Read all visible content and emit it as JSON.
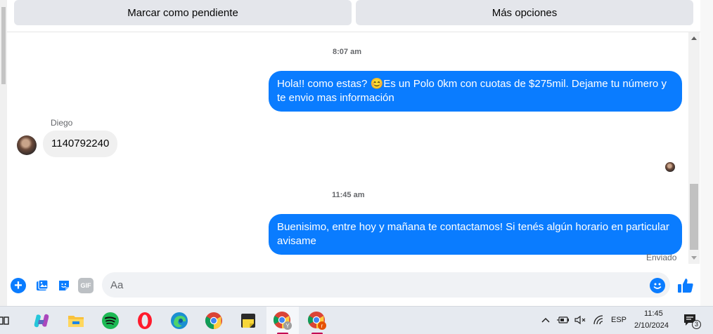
{
  "toolbar": {
    "mark_pending_label": "Marcar como pendiente",
    "more_options_label": "Más opciones"
  },
  "conversation": {
    "messages": [
      {
        "type": "timestamp",
        "text": "8:07 am"
      },
      {
        "type": "outgoing",
        "text": "Hola!! como estas? 😊Es un Polo 0km con cuotas de $275mil. Dejame tu número y te envio mas información"
      },
      {
        "type": "incoming",
        "sender": "Diego",
        "text": "1140792240"
      },
      {
        "type": "timestamp",
        "text": "11:45 am"
      },
      {
        "type": "outgoing",
        "text": "Buenisimo, entre hoy y mañana te contactamos! Si tenés algún horario en particular avisame",
        "status": "Enviado"
      }
    ]
  },
  "composer": {
    "placeholder": "Aa",
    "gif_label": "GIF",
    "icons": [
      "plus-icon",
      "image-icon",
      "sticker-icon",
      "gif-icon",
      "emoji-icon",
      "like-icon"
    ]
  },
  "colors": {
    "accent": "#0a7cff",
    "incoming_bubble": "#f0f0f0",
    "button_bg": "#e4e6eb"
  },
  "taskbar": {
    "apps": [
      "task-view-icon",
      "copilot-icon",
      "file-explorer-icon",
      "spotify-icon",
      "opera-icon",
      "edge-icon",
      "chrome-icon",
      "sticky-notes-icon",
      "chrome-profile-y-icon",
      "chrome-profile-r-icon"
    ],
    "language": "ESP",
    "time": "11:45",
    "date": "2/10/2024",
    "notification_count": "3"
  }
}
